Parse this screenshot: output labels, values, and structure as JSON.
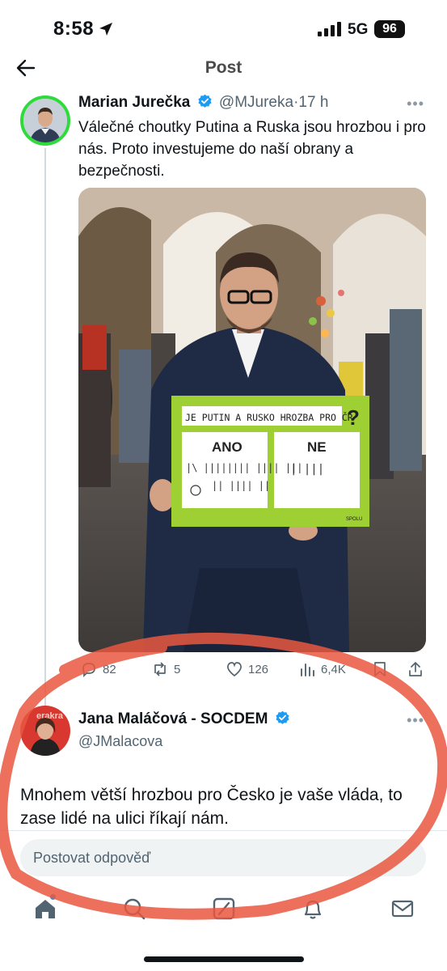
{
  "status_bar": {
    "time": "8:58",
    "network": "5G",
    "battery": "96"
  },
  "header": {
    "title": "Post"
  },
  "post": {
    "author_name": "Marian Jurečka",
    "handle": "@MJureka",
    "separator": "·",
    "time_ago": "17 h",
    "text": "Válečné choutky Putina a Ruska jsou hrozbou i pro nás. Proto investujeme do naší obrany a bezpečnosti.",
    "sign": {
      "question": "JE PUTIN A RUSKO  HROZBA PRO ČR",
      "qmark": "?",
      "yes_label": "ANO",
      "no_label": "NE",
      "tally_yes": "|\\ |||||||| |||| |||",
      "tally_yes2": "|| |||| ||",
      "tally_no": "| |||",
      "brand": "SPOLU"
    },
    "actions": {
      "replies": "82",
      "reposts": "5",
      "likes": "126",
      "views": "6,4K"
    }
  },
  "reply": {
    "author_name": "Jana Maláčová - SOCDEM",
    "handle": "@JMalacova",
    "avatar_text": "erakra",
    "text": "Mnohem větší hrozbou pro Česko je vaše vláda, to zase lidé na ulici říkají nám."
  },
  "compose": {
    "placeholder": "Postovat odpověď"
  },
  "tabbar": {
    "items": [
      "home-icon",
      "search-icon",
      "grok-icon",
      "notifications-icon",
      "messages-icon"
    ]
  },
  "colors": {
    "verified": "#1d9bf0",
    "avatar_ring": "#2ddc3a",
    "sign_green": "#9ed033",
    "annotation_red": "#e9573f"
  }
}
